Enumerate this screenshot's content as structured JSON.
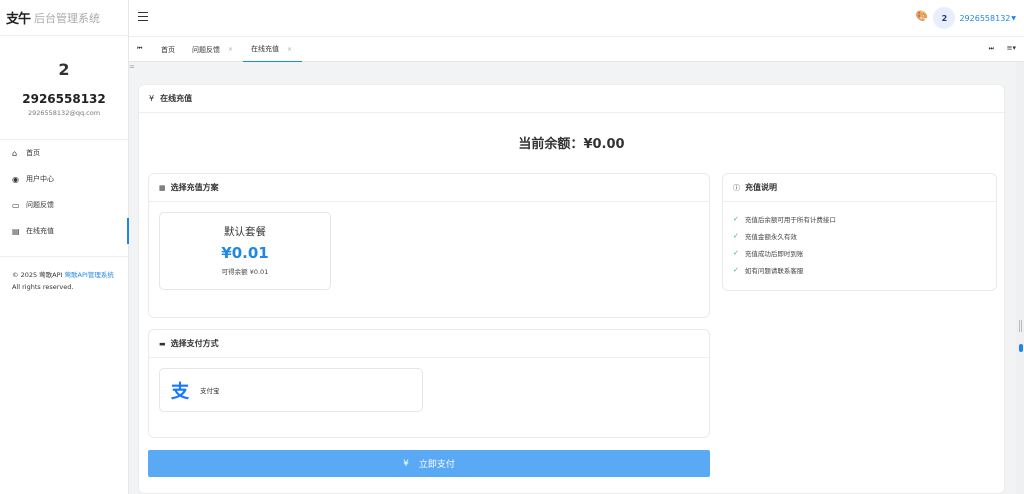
{
  "brand": {
    "logo": "支午",
    "title": "后台管理系统"
  },
  "profile": {
    "avatar_text": "2",
    "name": "2926558132",
    "email": "2926558132@qq.com"
  },
  "nav": [
    {
      "label": "首页",
      "icon": "home-icon"
    },
    {
      "label": "用户中心",
      "icon": "user-circle-icon"
    },
    {
      "label": "问题反馈",
      "icon": "feedback-icon"
    },
    {
      "label": "在线充值",
      "icon": "card-icon"
    }
  ],
  "copyright": {
    "prefix": "© 2025 莺歌API ",
    "link": "莺歌API管理系统",
    "suffix": " All rights reserved."
  },
  "topbar": {
    "avatar_text": "2",
    "user_name": "2926558132"
  },
  "tabs": [
    {
      "label": "首页"
    },
    {
      "label": "问题反馈"
    },
    {
      "label": "在线充值"
    }
  ],
  "main": {
    "title": "在线充值",
    "balance_label": "当前余额：",
    "balance_value": "¥0.00",
    "plans_title": "选择充值方案",
    "plan": {
      "name": "默认套餐",
      "price": "¥0.01",
      "note": "可得余额 ¥0.01"
    },
    "notes_title": "充值说明",
    "notes": [
      "充值后余额可用于所有计费接口",
      "充值金额永久有效",
      "充值成功后即时到账",
      "如有问题请联系客服"
    ],
    "payment_title": "选择支付方式",
    "payment_method": "支付宝",
    "pay_button": "立即支付"
  },
  "colors": {
    "accent": "#1e88e5",
    "button": "#5aa9f5",
    "success": "#36b37e"
  }
}
